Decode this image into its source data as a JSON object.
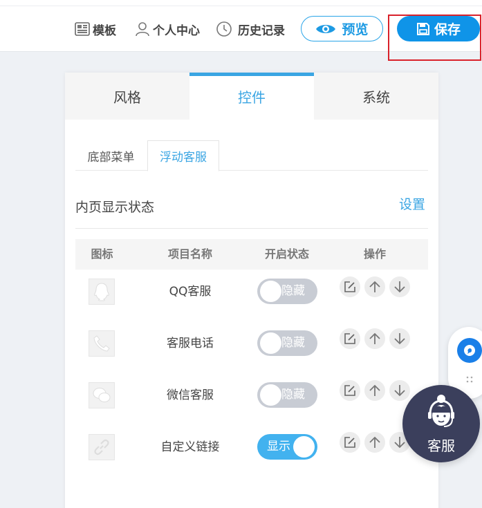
{
  "toolbar": {
    "template_label": "模板",
    "profile_label": "个人中心",
    "history_label": "历史记录",
    "preview_label": "预览",
    "save_label": "保存"
  },
  "panel": {
    "main_tabs": [
      {
        "label": "风格",
        "active": false
      },
      {
        "label": "控件",
        "active": true
      },
      {
        "label": "系统",
        "active": false
      }
    ],
    "sub_tabs": [
      {
        "label": "底部菜单",
        "active": false
      },
      {
        "label": "浮动客服",
        "active": true
      }
    ],
    "section_title": "内页显示状态",
    "section_link": "设置",
    "table": {
      "headers": [
        "图标",
        "项目名称",
        "开启状态",
        "操作"
      ],
      "rows": [
        {
          "icon": "qq-icon",
          "name": "QQ客服",
          "status": "隐藏",
          "enabled": false
        },
        {
          "icon": "phone-icon",
          "name": "客服电话",
          "status": "隐藏",
          "enabled": false
        },
        {
          "icon": "wechat-icon",
          "name": "微信客服",
          "status": "隐藏",
          "enabled": false
        },
        {
          "icon": "link-icon",
          "name": "自定义链接",
          "status": "显示",
          "enabled": true
        }
      ]
    }
  },
  "floating": {
    "service_label": "客服"
  },
  "colors": {
    "accent": "#3aa5e3",
    "save_button": "#0f94e8",
    "toggle_off": "#c8ccd4",
    "toggle_on": "#42b2ef",
    "service_bubble": "#3b3f5c",
    "highlight_box": "#d9212a"
  }
}
